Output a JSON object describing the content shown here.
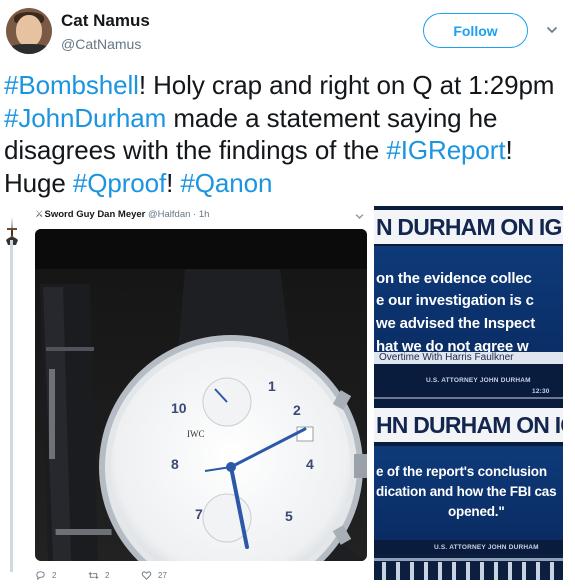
{
  "tweet": {
    "author": {
      "display_name": "Cat Namus",
      "handle": "@CatNamus"
    },
    "follow_label": "Follow",
    "text_parts": [
      {
        "text": "#Bombshell",
        "hashtag": true
      },
      {
        "text": "! Holy crap and right on Q at 1:29pm ",
        "hashtag": false
      },
      {
        "text": "#JohnDurham",
        "hashtag": true
      },
      {
        "text": " made a statement saying he disagrees with the findings of the ",
        "hashtag": false
      },
      {
        "text": "#IGReport",
        "hashtag": true
      },
      {
        "text": "! Huge ",
        "hashtag": false
      },
      {
        "text": "#Qproof",
        "hashtag": true
      },
      {
        "text": "! ",
        "hashtag": false
      },
      {
        "text": "#Qanon",
        "hashtag": true
      }
    ]
  },
  "quoted_tweet": {
    "name": "Sword Guy Dan Meyer",
    "handle": "@Halfdan",
    "time": "1h",
    "separator": "·",
    "watch_dial": {
      "brand": "IWC",
      "numerals": [
        "10",
        "8",
        "7",
        "5",
        "4",
        "2",
        "1"
      ]
    },
    "replies": "2",
    "retweets": "2",
    "likes": "27"
  },
  "news_screens": [
    {
      "headline": "N DURHAM ON IG",
      "quote_lines": [
        "on the evidence collec",
        "e our investigation is c",
        "we advised the Inspect",
        "hat we do not agree w"
      ],
      "show_name": "Overtime With Harris Faulkner",
      "attorney_label": "U.S. ATTORNEY JOHN DURHAM",
      "time_fragment": "12:30"
    },
    {
      "headline": "HN DURHAM ON IG RE",
      "quote_lines": [
        "e of the report's conclusion",
        "dication and how the FBI cas",
        "opened.\""
      ],
      "attorney_label": "U.S. ATTORNEY JOHN DURHAM"
    }
  ],
  "colors": {
    "hashtag": "#1b95e0",
    "follow": "#1da1f2",
    "muted": "#657786",
    "news_navy": "#0a1c3d",
    "news_blue": "#0e3a7a"
  },
  "icons": {
    "caret": "chevron-down-icon",
    "reply": "reply-icon",
    "retweet": "retweet-icon",
    "like": "heart-icon"
  }
}
